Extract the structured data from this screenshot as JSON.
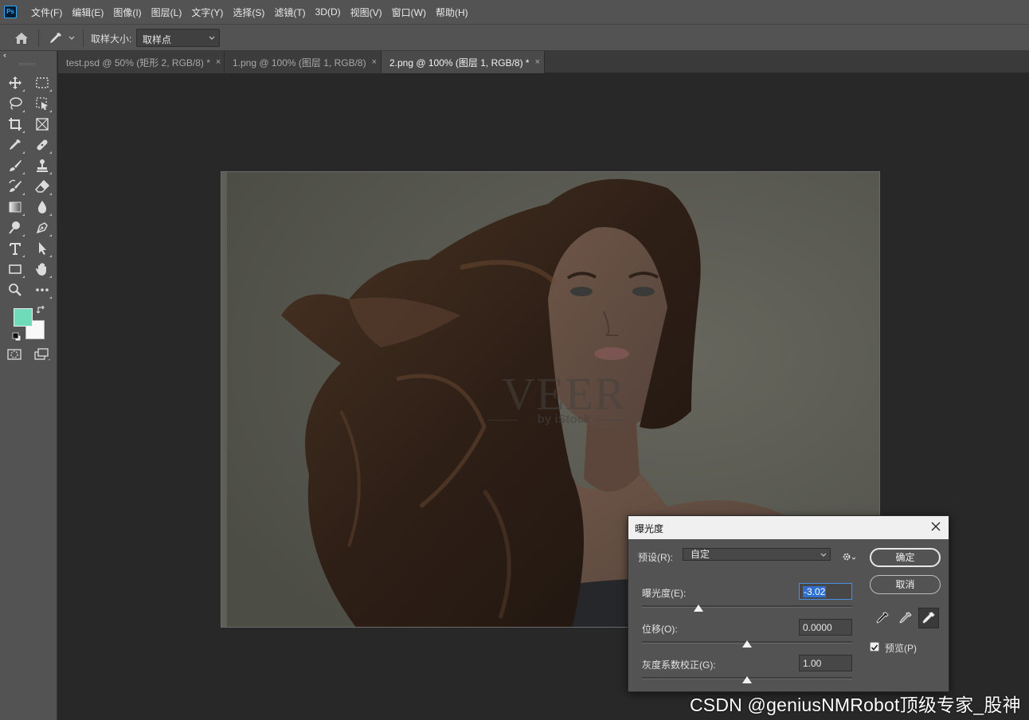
{
  "app": {
    "logo_text": "Ps",
    "menu": [
      "文件(F)",
      "编辑(E)",
      "图像(I)",
      "图层(L)",
      "文字(Y)",
      "选择(S)",
      "滤镜(T)",
      "3D(D)",
      "视图(V)",
      "窗口(W)",
      "帮助(H)"
    ]
  },
  "options_bar": {
    "home_icon": "home-icon",
    "tool_icon": "eyedropper-icon",
    "sample_size_label": "取样大小:",
    "sample_size_value": "取样点"
  },
  "toolbox": {
    "collapse_glyph": "‹‹",
    "foreground_color": "#70dbb9",
    "background_color": "#f8f8f8"
  },
  "tabs": [
    {
      "label": "test.psd @ 50% (矩形 2, RGB/8) *",
      "active": false
    },
    {
      "label": "1.png @ 100% (图层 1, RGB/8)",
      "active": false
    },
    {
      "label": "2.png @ 100% (图层 1, RGB/8) *",
      "active": true
    }
  ],
  "tab_close_glyph": "×",
  "document": {
    "watermark_main": "VEER",
    "watermark_sub": "by iStock"
  },
  "exposure_dialog": {
    "title": "曝光度",
    "preset_label": "预设(R):",
    "preset_value": "自定",
    "ok_label": "确定",
    "cancel_label": "取消",
    "exposure_label": "曝光度(E):",
    "exposure_value": "-3.02",
    "exposure_slider_fraction": 0.27,
    "offset_label": "位移(O):",
    "offset_value": "0.0000",
    "offset_slider_fraction": 0.5,
    "gamma_label": "灰度系数校正(G):",
    "gamma_value": "1.00",
    "gamma_slider_fraction": 0.5,
    "preview_label": "预览(P)",
    "preview_checked": true
  },
  "watermark": "CSDN @geniusNMRobot顶级专家_股神"
}
